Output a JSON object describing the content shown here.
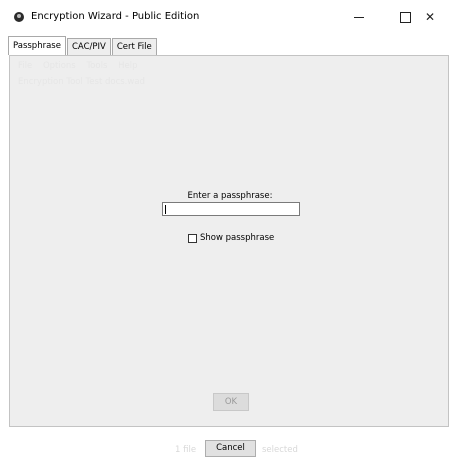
{
  "window": {
    "title": "Encryption Wizard - Public Edition",
    "minimize_glyph": "—",
    "close_glyph": "✕"
  },
  "tabs": [
    {
      "label": "Passphrase",
      "active": true
    },
    {
      "label": "CAC/PIV",
      "active": false
    },
    {
      "label": "Cert File",
      "active": false
    }
  ],
  "background_menu": [
    "File",
    "Options",
    "Tools",
    "Help"
  ],
  "background_path": "Encryption Tool Test docs.wad",
  "passphrase_dialog": {
    "prompt_label": "Enter a passphrase:",
    "passphrase_value": "",
    "show_passphrase_label": "Show passphrase",
    "show_passphrase_checked": false,
    "ok_label": "OK",
    "ok_enabled": false
  },
  "footer": {
    "background_text_left": "1 file",
    "background_text_right": "selected",
    "cancel_label": "Cancel"
  },
  "icons": [
    "app-icon",
    "minimize-icon",
    "maximize-icon",
    "close-icon"
  ]
}
